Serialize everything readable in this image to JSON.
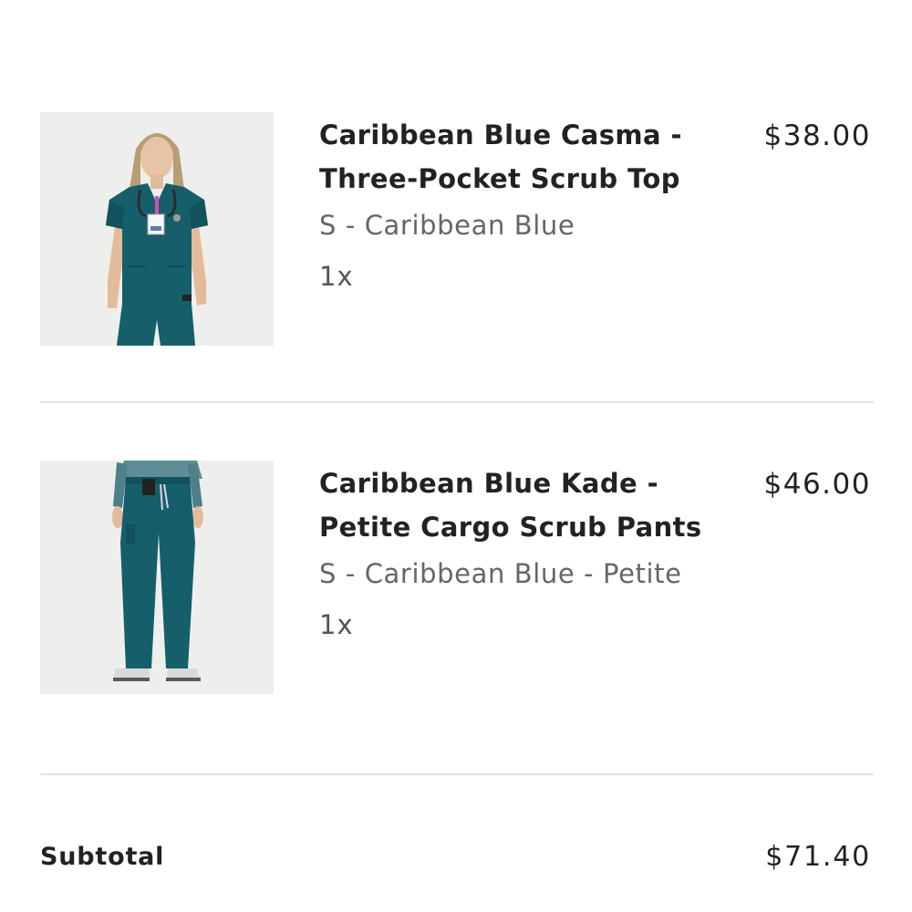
{
  "cart": {
    "items": [
      {
        "name_line1": "Caribbean Blue Casma -",
        "name_line2": "Three-Pocket Scrub Top",
        "variant": "S - Caribbean Blue",
        "quantity": "1x",
        "price": "$38.00",
        "image": "scrub-top-photo"
      },
      {
        "name_line1": "Caribbean Blue Kade -",
        "name_line2": "Petite Cargo Scrub Pants",
        "variant": "S - Caribbean Blue - Petite",
        "quantity": "1x",
        "price": "$46.00",
        "image": "scrub-pants-photo"
      }
    ],
    "subtotal_label": "Subtotal",
    "subtotal_value": "$71.40"
  },
  "colors": {
    "scrub": "#155f6b",
    "text": "#222222",
    "muted": "#666666",
    "divider": "#e3e3e3"
  }
}
